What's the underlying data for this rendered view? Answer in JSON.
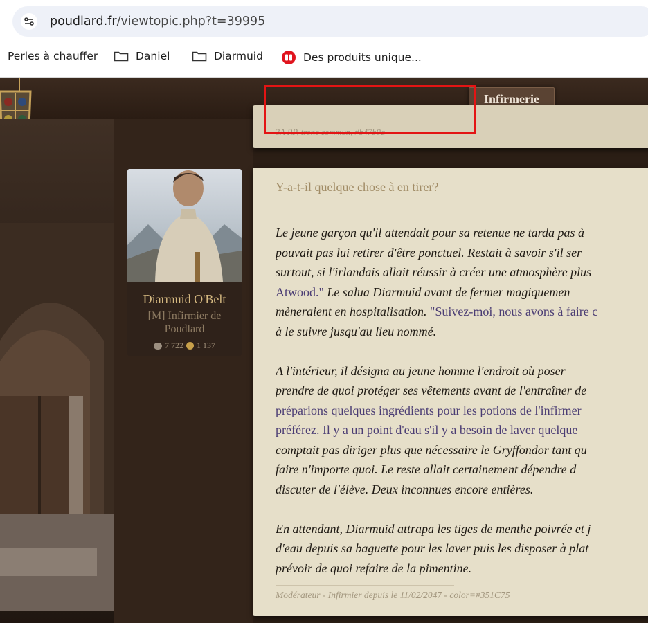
{
  "browser": {
    "url_host": "poudlard.fr",
    "url_path": "/viewtopic.php?t=39995",
    "bookmarks": [
      {
        "label": "Perles à chauffer",
        "icon": "none"
      },
      {
        "label": "Daniel",
        "icon": "folder-icon"
      },
      {
        "label": "Diarmuid",
        "icon": "folder-icon"
      },
      {
        "label": "Des produits unique...",
        "icon": "red-logo-icon"
      }
    ]
  },
  "forum": {
    "tab_label": "Infirmerie",
    "prev_post_signature": "3A RP, tronc commun, #b47b0a"
  },
  "author": {
    "name": "Diarmuid O'Belt",
    "rank": "[M] Infirmier de Poudlard",
    "messages": "7 722",
    "coins": "1 137"
  },
  "post": {
    "title": "Y-a-t-il quelque chose à en tirer?",
    "lines": [
      [
        {
          "t": "Le jeune garçon qu'il attendait pour sa retenue ne tarda pas à ",
          "d": false
        }
      ],
      [
        {
          "t": "pouvait pas lui retirer d'être ponctuel. Restait à savoir s'il ser",
          "d": false
        }
      ],
      [
        {
          "t": "surtout, si l'irlandais allait réussir à créer une atmosphère plus",
          "d": false
        }
      ],
      [
        {
          "t": "Atwood.\"",
          "d": true
        },
        {
          "t": " Le salua Diarmuid avant de fermer magiquemen",
          "d": false
        }
      ],
      [
        {
          "t": "mèneraient en hospitalisation. ",
          "d": false
        },
        {
          "t": "\"Suivez-moi, nous avons à faire c",
          "d": true
        }
      ],
      [
        {
          "t": "à le suivre jusqu'au lieu nommé.",
          "d": false
        }
      ],
      [],
      [
        {
          "t": "A l'intérieur, il désigna au jeune homme l'endroit où poser",
          "d": false
        }
      ],
      [
        {
          "t": "prendre de quoi protéger ses vêtements avant de l'entraîner de",
          "d": false
        }
      ],
      [
        {
          "t": "préparions quelques ingrédients pour les potions de l'infirmer",
          "d": true
        }
      ],
      [
        {
          "t": "préférez. Il y a un point d'eau s'il y a besoin de laver quelque",
          "d": true
        }
      ],
      [
        {
          "t": "comptait pas diriger plus que nécessaire le Gryffondor tant qu",
          "d": false
        }
      ],
      [
        {
          "t": "faire n'importe quoi. Le reste allait certainement dépendre d",
          "d": false
        }
      ],
      [
        {
          "t": "discuter de l'élève. Deux inconnues encore entières.",
          "d": false
        }
      ],
      [],
      [
        {
          "t": "En attendant, Diarmuid attrapa les tiges de menthe poivrée et j",
          "d": false
        }
      ],
      [
        {
          "t": "d'eau depuis sa baguette pour les laver puis les disposer à plat",
          "d": false
        }
      ],
      [
        {
          "t": "prévoir de quoi refaire de la pimentine.",
          "d": false
        }
      ]
    ],
    "signature": "Modérateur - Infirmier depuis le 11/02/2047 - color=#351C75"
  },
  "colors": {
    "dialogue": "#4b3d74",
    "highlight_box": "#e31414"
  }
}
